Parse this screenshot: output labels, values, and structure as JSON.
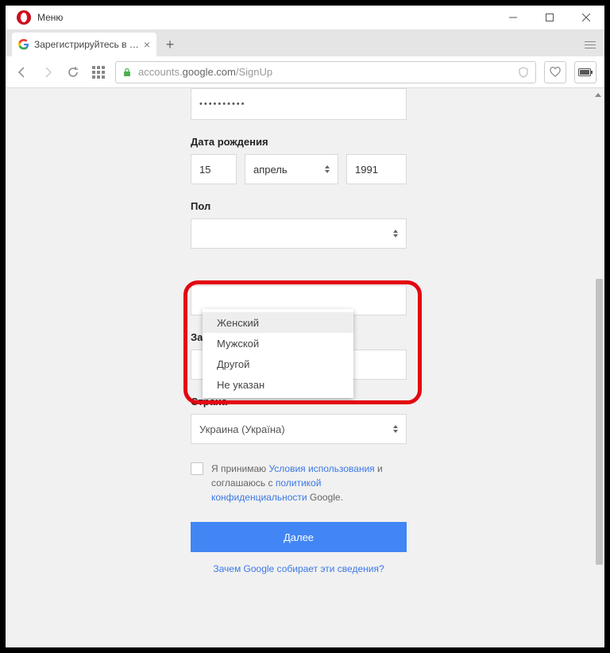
{
  "window": {
    "menu_label": "Меню"
  },
  "tab": {
    "title": "Зарегистрируйтесь в Goo"
  },
  "address": {
    "prefix": "accounts.",
    "host": "google.com",
    "path": "/SignUp"
  },
  "form": {
    "password_mask": "••••••••••",
    "dob_label": "Дата рождения",
    "day": "15",
    "month": "апрель",
    "year": "1991",
    "gender_label": "Пол",
    "gender_options": {
      "o0": "Женский",
      "o1": "Мужской",
      "o2": "Другой",
      "o3": "Не указан"
    },
    "backup_email_label": "Запасной адрес эл. почты",
    "country_label": "Страна",
    "country_value": "Украина (Україна)",
    "consent": {
      "t1": "Я принимаю ",
      "l1": "Условия использования",
      "t2": " и соглашаюсь с ",
      "l2": "политикой конфиденциальности",
      "t3": " Google."
    },
    "next_label": "Далее",
    "why_link": "Зачем Google собирает эти сведения?"
  }
}
